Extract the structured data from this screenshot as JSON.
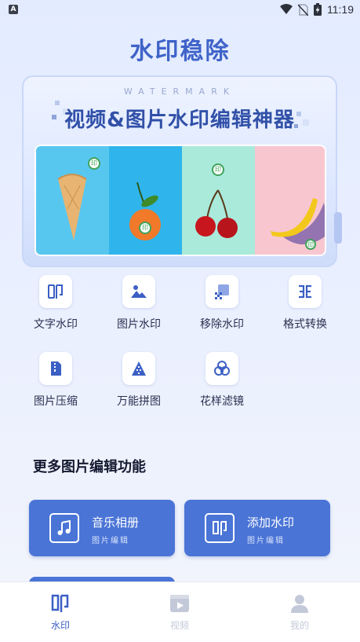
{
  "status_bar": {
    "left_icon": "A",
    "time": "11:19",
    "icons": [
      "wifi-icon",
      "no-sim-icon",
      "battery-charging-icon"
    ]
  },
  "app": {
    "title": "水印稳除"
  },
  "banner": {
    "subtitle": "WATERMARK",
    "title": "视频&图片水印编辑神器",
    "photos": [
      "ice-cream",
      "orange",
      "cherries",
      "banana"
    ],
    "badge_text": "印"
  },
  "tools": [
    {
      "label": "文字水印",
      "icon": "text-watermark-icon"
    },
    {
      "label": "图片水印",
      "icon": "image-watermark-icon"
    },
    {
      "label": "移除水印",
      "icon": "remove-watermark-icon"
    },
    {
      "label": "格式转换",
      "icon": "format-convert-icon"
    },
    {
      "label": "图片压缩",
      "icon": "compress-icon"
    },
    {
      "label": "万能拼图",
      "icon": "collage-icon"
    },
    {
      "label": "花样滤镜",
      "icon": "filter-icon"
    }
  ],
  "more_section": {
    "title": "更多图片编辑功能",
    "cards": [
      {
        "title": "音乐相册",
        "subtitle": "图片编辑",
        "icon": "music-note-icon"
      },
      {
        "title": "添加水印",
        "subtitle": "图片编辑",
        "icon": "stamp-icon"
      }
    ]
  },
  "nav": {
    "items": [
      {
        "label": "水印",
        "icon": "stamp-icon",
        "active": true
      },
      {
        "label": "视频",
        "icon": "video-icon",
        "active": false
      },
      {
        "label": "我的",
        "icon": "user-icon",
        "active": false
      }
    ]
  },
  "colors": {
    "primary": "#4a74d6",
    "title": "#3f63c8",
    "nav_active": "#3b5fc4",
    "nav_inactive": "#c3c9d8"
  }
}
